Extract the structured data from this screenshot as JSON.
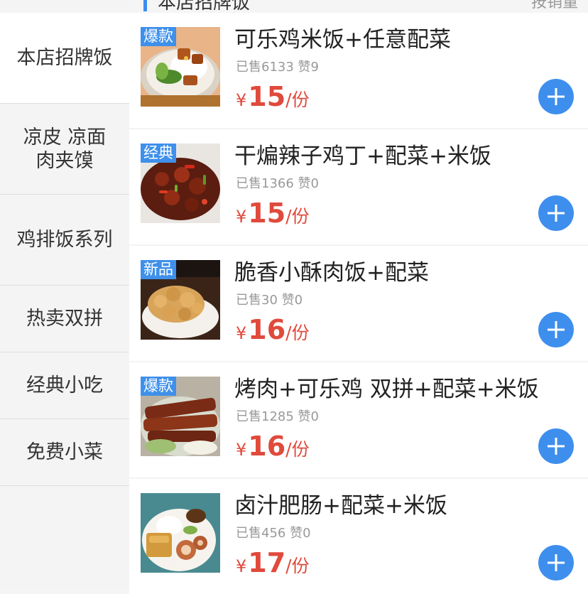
{
  "sidebar": {
    "items": [
      {
        "label": "本店招牌饭",
        "active": true
      },
      {
        "label": "凉皮 凉面 肉夹馍",
        "active": false
      },
      {
        "label": "鸡排饭系列",
        "active": false
      },
      {
        "label": "热卖双拼",
        "active": false
      },
      {
        "label": "经典小吃",
        "active": false
      },
      {
        "label": "免费小菜",
        "active": false
      }
    ]
  },
  "section": {
    "title": "本店招牌饭",
    "more": "按销量"
  },
  "products": [
    {
      "badge": "爆款",
      "name": "可乐鸡米饭+任意配菜",
      "stats": "已售6133 赞9",
      "currency": "¥",
      "price": "15",
      "unit": "/份",
      "image": "cola-chicken-rice"
    },
    {
      "badge": "经典",
      "name": "干煸辣子鸡丁+配菜+米饭",
      "stats": "已售1366 赞0",
      "currency": "¥",
      "price": "15",
      "unit": "/份",
      "image": "spicy-chicken"
    },
    {
      "badge": "新品",
      "name": "脆香小酥肉饭+配菜",
      "stats": "已售30 赞0",
      "currency": "¥",
      "price": "16",
      "unit": "/份",
      "image": "crispy-pork"
    },
    {
      "badge": "爆款",
      "name": "烤肉+可乐鸡 双拼+配菜+米饭",
      "stats": "已售1285 赞0",
      "currency": "¥",
      "price": "16",
      "unit": "/份",
      "image": "bbq-combo"
    },
    {
      "badge": "",
      "name": "卤汁肥肠+配菜+米饭",
      "stats": "已售456 赞0",
      "currency": "¥",
      "price": "17",
      "unit": "/份",
      "image": "braised-intestine"
    }
  ],
  "colors": {
    "accent": "#3e8fed",
    "price": "#e04a3c",
    "badge": "#3e90ea"
  },
  "icons": {
    "add": "plus-icon"
  }
}
